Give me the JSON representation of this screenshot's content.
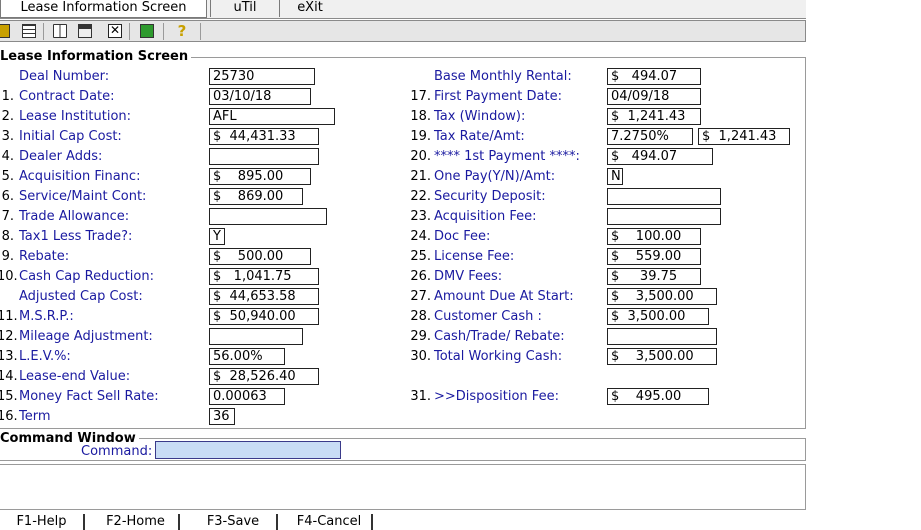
{
  "menu": {
    "lease": "Lease Information Screen",
    "util": "uTil",
    "exit": "eXit"
  },
  "panel_title": "Lease Information Screen",
  "left_fields": [
    {
      "num": "",
      "label": "Deal Number:",
      "value": "25730"
    },
    {
      "num": "1.",
      "label": "Contract Date:",
      "value": "03/10/18"
    },
    {
      "num": "2.",
      "label": "Lease Institution:",
      "value": "AFL"
    },
    {
      "num": "3.",
      "label": "Initial Cap Cost:",
      "value": "$  44,431.33"
    },
    {
      "num": "4.",
      "label": "Dealer Adds:",
      "value": ""
    },
    {
      "num": "5.",
      "label": "Acquisition Financ:",
      "value": "$    895.00"
    },
    {
      "num": "6.",
      "label": "Service/Maint Cont:",
      "value": "$    869.00"
    },
    {
      "num": "7.",
      "label": "Trade Allowance:",
      "value": ""
    },
    {
      "num": "8.",
      "label": "Tax1 Less Trade?:",
      "value": "Y"
    },
    {
      "num": "9.",
      "label": "Rebate:",
      "value": "$    500.00"
    },
    {
      "num": "10.",
      "label": "Cash Cap Reduction:",
      "value": "$   1,041.75"
    },
    {
      "num": "",
      "label": "Adjusted Cap Cost:",
      "value": "$  44,653.58"
    },
    {
      "num": "11.",
      "label": "M.S.R.P.:",
      "value": "$  50,940.00"
    },
    {
      "num": "12.",
      "label": "Mileage Adjustment:",
      "value": ""
    },
    {
      "num": "13.",
      "label": "L.E.V.%:",
      "value": "56.00%"
    },
    {
      "num": "14.",
      "label": "Lease-end Value:",
      "value": "$  28,526.40"
    },
    {
      "num": "15.",
      "label": "Money Fact Sell Rate:",
      "value": "0.00063"
    },
    {
      "num": "16.",
      "label": "Term",
      "value": "36"
    }
  ],
  "right_fields": [
    {
      "num": "",
      "label": "Base Monthly Rental:",
      "value": "$   494.07"
    },
    {
      "num": "17.",
      "label": "First Payment Date:",
      "value": "04/09/18"
    },
    {
      "num": "18.",
      "label": "Tax  (Window):",
      "value": "$  1,241.43"
    },
    {
      "num": "19.",
      "label": "Tax Rate/Amt:",
      "value": "7.2750%",
      "value2": "$  1,241.43"
    },
    {
      "num": "20.",
      "label": "**** 1st Payment ****:",
      "value": "$   494.07"
    },
    {
      "num": "21.",
      "label": "One Pay(Y/N)/Amt:",
      "value": "N"
    },
    {
      "num": "22.",
      "label": "Security Deposit:",
      "value": ""
    },
    {
      "num": "23.",
      "label": "Acquisition Fee:",
      "value": ""
    },
    {
      "num": "24.",
      "label": "Doc Fee:",
      "value": "$    100.00"
    },
    {
      "num": "25.",
      "label": "License Fee:",
      "value": "$    559.00"
    },
    {
      "num": "26.",
      "label": "DMV Fees:",
      "value": "$     39.75"
    },
    {
      "num": "27.",
      "label": "Amount Due At Start:",
      "value": "$    3,500.00"
    },
    {
      "num": "28.",
      "label": "Customer Cash :",
      "value": "$  3,500.00"
    },
    {
      "num": "29.",
      "label": "Cash/Trade/ Rebate:",
      "value": ""
    },
    {
      "num": "30.",
      "label": "Total Working Cash:",
      "value": "$    3,500.00"
    },
    {
      "num": "31.",
      "label": ">>Disposition Fee:",
      "value": "$    495.00"
    }
  ],
  "command": {
    "title": "Command Window",
    "label": "Command:",
    "value": ""
  },
  "fkeys": [
    "F1-Help",
    "F2-Home",
    "F3-Save",
    "F4-Cancel"
  ],
  "colors": {
    "label": "#1a1aa0",
    "command_input": "#c8dcf5"
  }
}
